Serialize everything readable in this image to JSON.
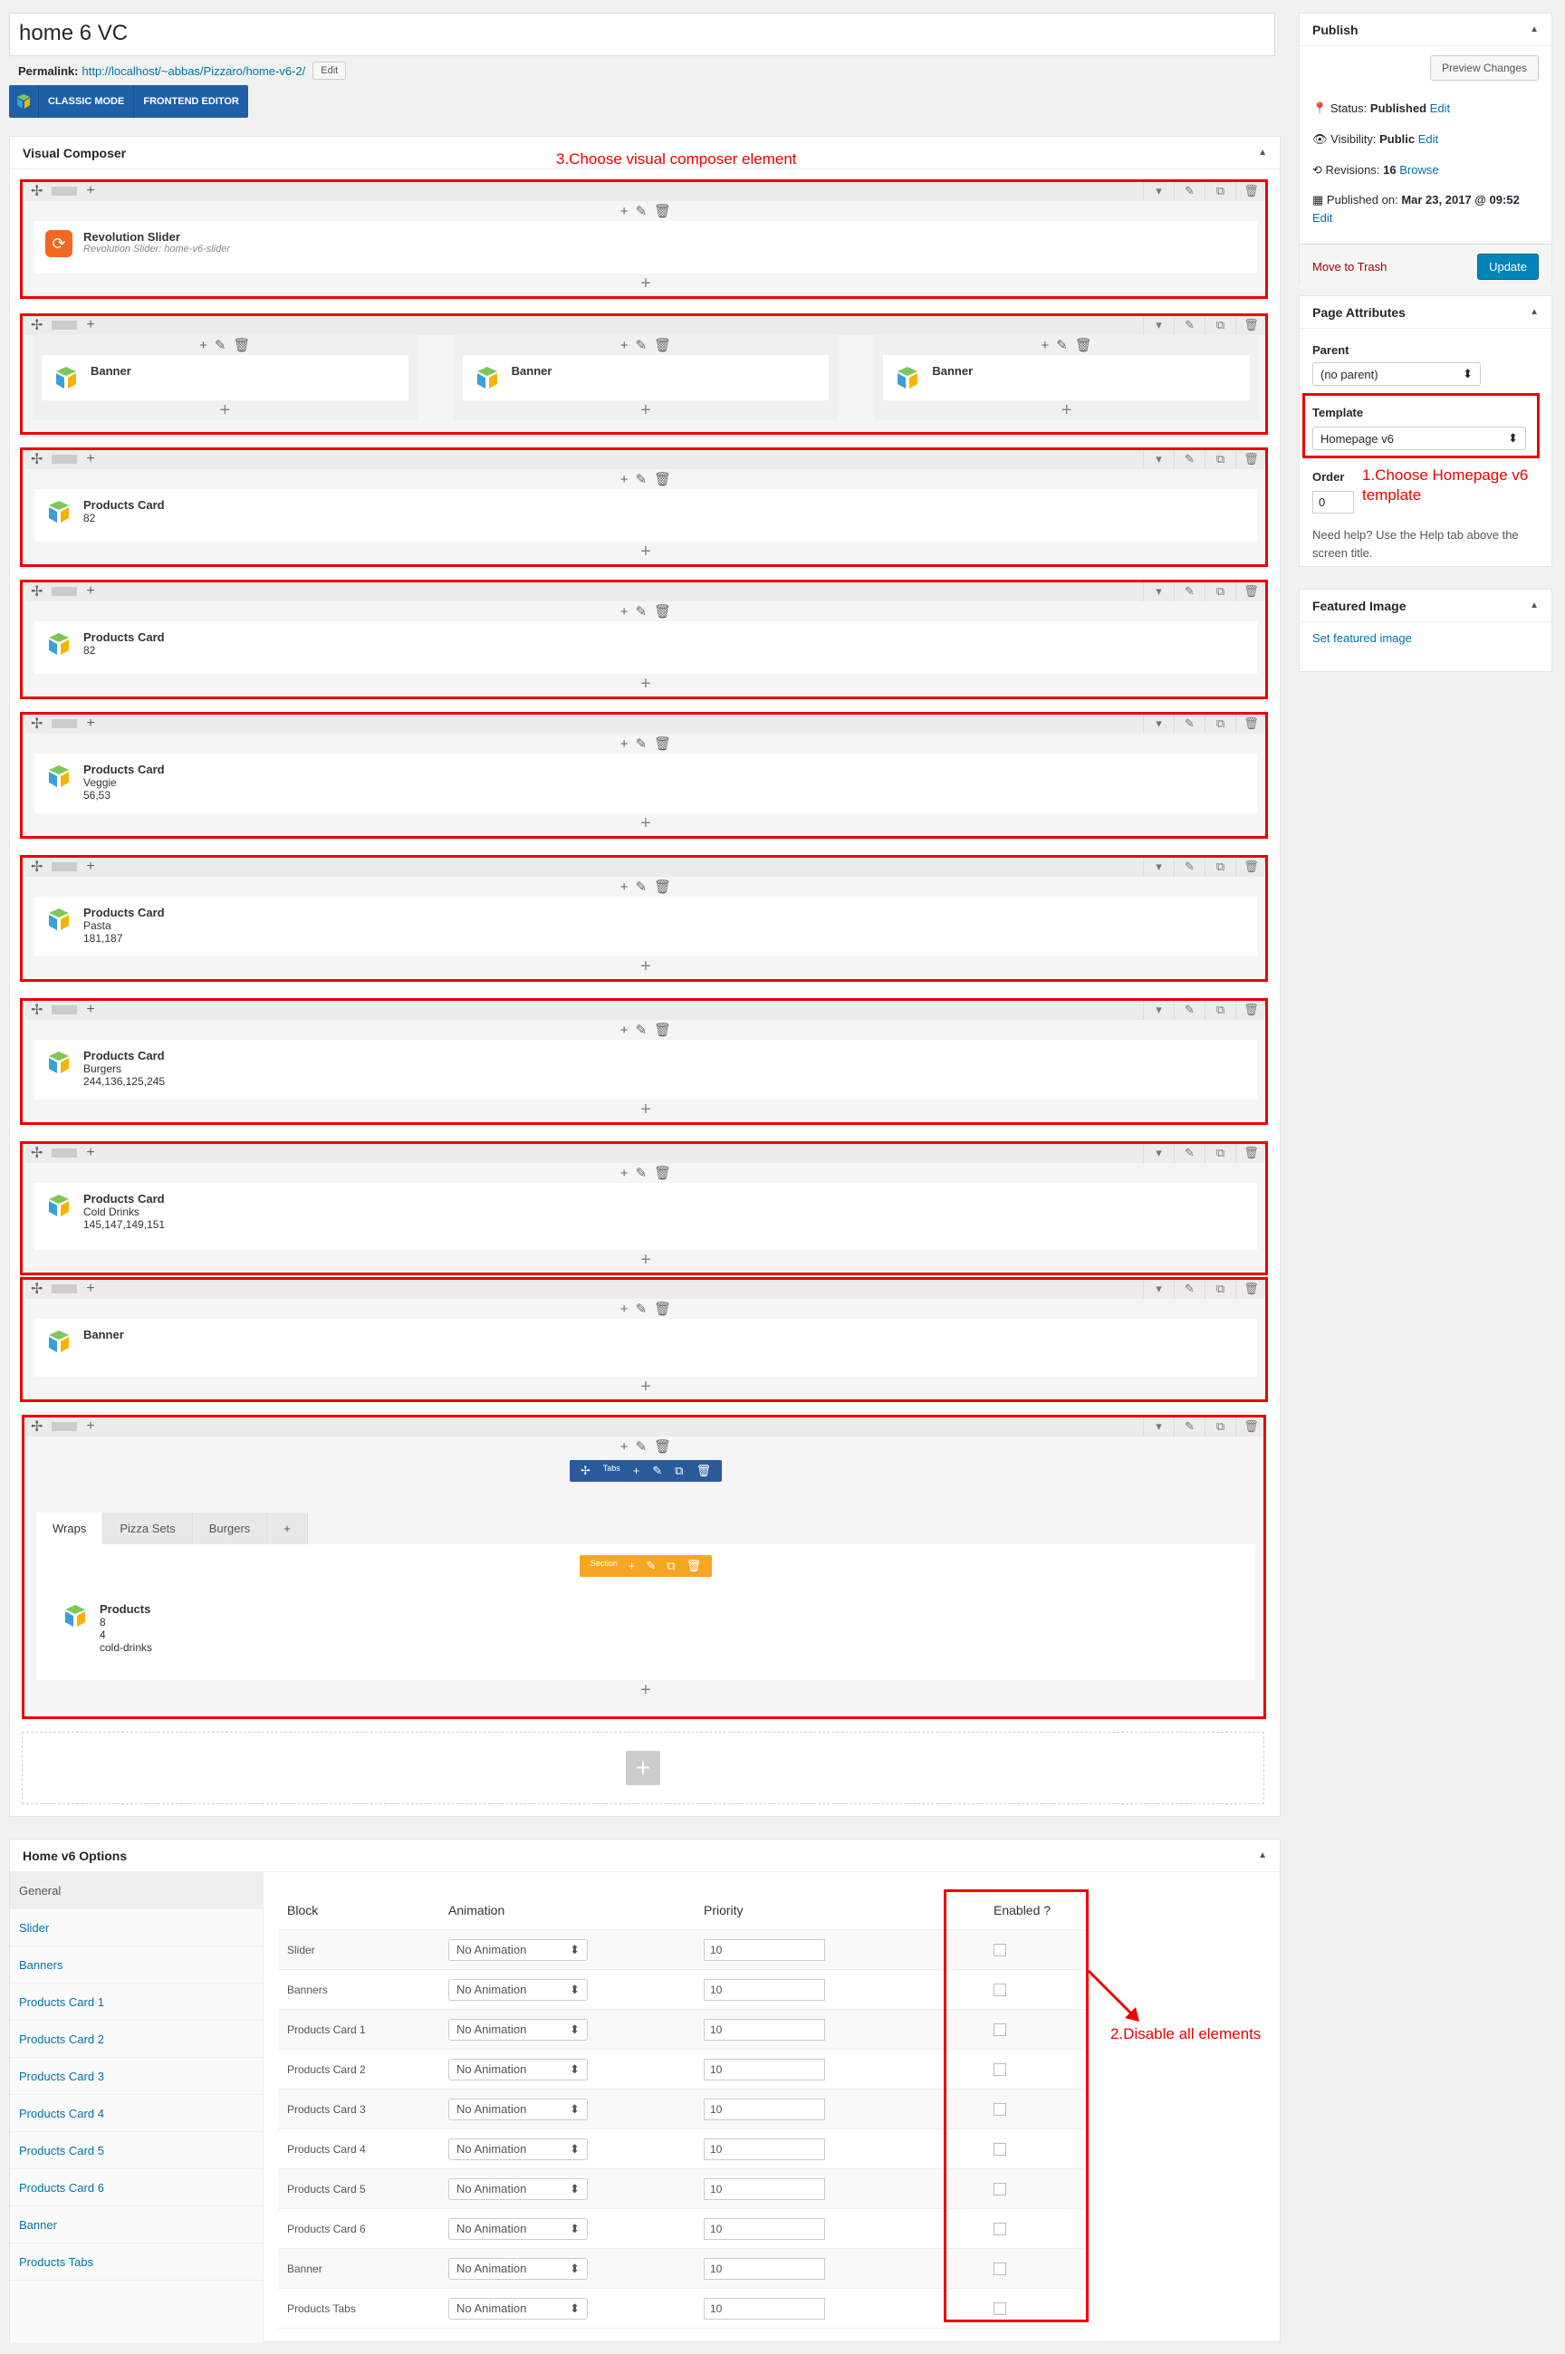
{
  "page": {
    "title": "home 6 VC",
    "permalink_label": "Permalink:",
    "permalink_url": "http://localhost/~abbas/Pizzaro/home-v6-2/",
    "permalink_edit": "Edit"
  },
  "vc_mode": {
    "classic": "CLASSIC MODE",
    "frontend": "FRONTEND EDITOR"
  },
  "vc_panel": {
    "title": "Visual Composer",
    "annotation": "3.Choose visual composer element"
  },
  "rows": [
    {
      "title": "Revolution Slider",
      "sub": "Revolution Slider: home-v6-slider",
      "lines": []
    },
    {
      "banners": [
        "Banner",
        "Banner",
        "Banner"
      ]
    },
    {
      "title": "Products Card",
      "lines": [
        "82"
      ]
    },
    {
      "title": "Products Card",
      "lines": [
        "82"
      ]
    },
    {
      "title": "Products Card",
      "lines": [
        "Veggie",
        "56,53"
      ]
    },
    {
      "title": "Products Card",
      "lines": [
        "Pasta",
        "181,187"
      ]
    },
    {
      "title": "Products Card",
      "lines": [
        "Burgers",
        "244,136,125,245"
      ]
    },
    {
      "title": "Products Card",
      "lines": [
        "Cold Drinks",
        "145,147,149,151"
      ]
    },
    {
      "title": "Banner",
      "lines": []
    }
  ],
  "tabs_row": {
    "tabs_label": "Tabs",
    "section_label": "Section",
    "tabs": [
      "Wraps",
      "Pizza Sets",
      "Burgers"
    ],
    "element_title": "Products",
    "lines": [
      "8",
      "4",
      "cold-drinks"
    ]
  },
  "publish": {
    "title": "Publish",
    "preview": "Preview Changes",
    "status_label": "Status:",
    "status": "Published",
    "visibility_label": "Visibility:",
    "visibility": "Public",
    "revisions_label": "Revisions:",
    "revisions": "16",
    "browse": "Browse",
    "published_label": "Published on:",
    "published": "Mar 23, 2017 @ 09:52",
    "edit": "Edit",
    "trash": "Move to Trash",
    "update": "Update"
  },
  "attributes": {
    "title": "Page Attributes",
    "parent_label": "Parent",
    "parent": "(no parent)",
    "template_label": "Template",
    "template": "Homepage v6",
    "order_label": "Order",
    "order": "0",
    "help": "Need help? Use the Help tab above the screen title.",
    "annotation": "1.Choose Homepage v6 template"
  },
  "featured": {
    "title": "Featured Image",
    "link": "Set featured image"
  },
  "options": {
    "title": "Home v6 Options",
    "nav": [
      "General",
      "Slider",
      "Banners",
      "Products Card 1",
      "Products Card 2",
      "Products Card 3",
      "Products Card 4",
      "Products Card 5",
      "Products Card 6",
      "Banner",
      "Products Tabs"
    ],
    "headers": [
      "Block",
      "Animation",
      "Priority",
      "Enabled ?"
    ],
    "rows": [
      "Slider",
      "Banners",
      "Products Card 1",
      "Products Card 2",
      "Products Card 3",
      "Products Card 4",
      "Products Card 5",
      "Products Card 6",
      "Banner",
      "Products Tabs"
    ],
    "animation": "No Animation",
    "priority": "10",
    "annotation": "2.Disable all elements"
  },
  "colors": {
    "annotation": "#e00000",
    "primary": "#0085ba",
    "vc_blue": "#1f5fa6"
  }
}
